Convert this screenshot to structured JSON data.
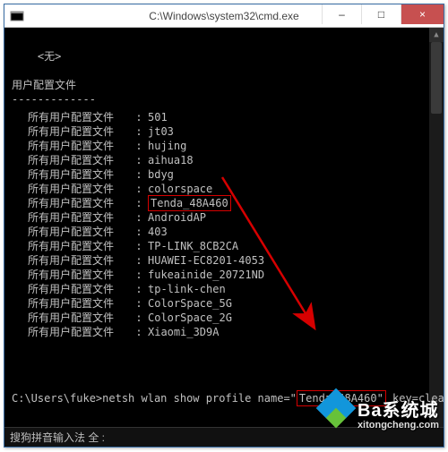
{
  "titlebar": {
    "title": "C:\\Windows\\system32\\cmd.exe",
    "minimize": "–",
    "maximize": "□",
    "close": "×"
  },
  "console": {
    "none_line": "    <无>",
    "section_heading": "用户配置文件",
    "section_underline": "-------------",
    "profile_label": "所有用户配置文件",
    "separator": ":",
    "profiles": [
      "501",
      "jt03",
      "hujing",
      "aihua18",
      "bdyg",
      "colorspace",
      "Tenda_48A460",
      "AndroidAP",
      "403",
      "TP-LINK_8CB2CA",
      "HUAWEI-EC8201-4053",
      "fukeainide_20721ND",
      "tp-link-chen",
      "ColorSpace_5G",
      "ColorSpace_2G",
      "Xiaomi_3D9A"
    ],
    "highlighted_profile_index": 6,
    "prompt_prefix": "C:\\Users\\fuke>",
    "command_before": "netsh wlan show profile name=\"",
    "command_highlight": "Tenda_48A460\"",
    "command_after": " key=clear"
  },
  "ime": {
    "text": "搜狗拼音输入法  全 :"
  },
  "scrollbar": {
    "up": "▲",
    "down": "▼"
  },
  "watermark": {
    "line1": "Ba系统城",
    "line2": "xitongcheng.com"
  }
}
